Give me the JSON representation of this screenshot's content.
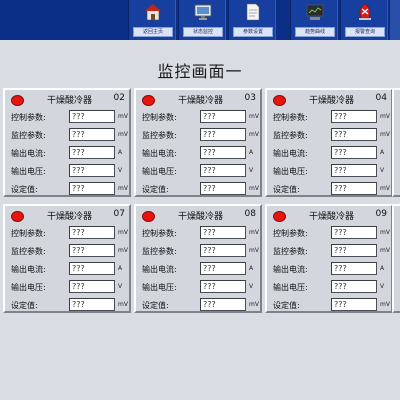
{
  "nav": {
    "items": [
      {
        "label": "返回主页",
        "icon": "home-icon"
      },
      {
        "label": "状态监控",
        "icon": "monitor-icon"
      },
      {
        "label": "参数设置",
        "icon": "document-icon"
      },
      {
        "label": "趋势曲线",
        "icon": "trend-monitor-icon"
      },
      {
        "label": "报警查询",
        "icon": "alarm-icon"
      }
    ]
  },
  "page": {
    "title": "监控画面一"
  },
  "labels": {
    "control": "控制参数:",
    "monitor": "监控参数:",
    "current": "输出电流:",
    "voltage": "输出电压:",
    "setpoint": "设定值:"
  },
  "panels": [
    {
      "name": "干燥酸冷器",
      "number": "02",
      "control_value": "???",
      "control_unit": "mV",
      "monitor_value": "???",
      "monitor_unit": "mV",
      "current_value": "???",
      "current_unit": "A",
      "voltage_value": "???",
      "voltage_unit": "V",
      "setpoint_value": "???",
      "setpoint_unit": "mV"
    },
    {
      "name": "干燥酸冷器",
      "number": "03",
      "control_value": "???",
      "control_unit": "mV",
      "monitor_value": "???",
      "monitor_unit": "mV",
      "current_value": "???",
      "current_unit": "A",
      "voltage_value": "???",
      "voltage_unit": "V",
      "setpoint_value": "???",
      "setpoint_unit": "mV"
    },
    {
      "name": "干燥酸冷器",
      "number": "04",
      "control_value": "???",
      "control_unit": "mV",
      "monitor_value": "???",
      "monitor_unit": "mV",
      "current_value": "???",
      "current_unit": "A",
      "voltage_value": "???",
      "voltage_unit": "V",
      "setpoint_value": "???",
      "setpoint_unit": "mV"
    },
    {
      "name": "干燥酸冷器",
      "number": "07",
      "control_value": "???",
      "control_unit": "mV",
      "monitor_value": "???",
      "monitor_unit": "mV",
      "current_value": "???",
      "current_unit": "A",
      "voltage_value": "???",
      "voltage_unit": "V",
      "setpoint_value": "???",
      "setpoint_unit": "mV"
    },
    {
      "name": "干燥酸冷器",
      "number": "08",
      "control_value": "???",
      "control_unit": "mV",
      "monitor_value": "???",
      "monitor_unit": "mV",
      "current_value": "???",
      "current_unit": "A",
      "voltage_value": "???",
      "voltage_unit": "V",
      "setpoint_value": "???",
      "setpoint_unit": "mV"
    },
    {
      "name": "干燥酸冷器",
      "number": "09",
      "control_value": "???",
      "control_unit": "mV",
      "monitor_value": "???",
      "monitor_unit": "mV",
      "current_value": "???",
      "current_unit": "A",
      "voltage_value": "???",
      "voltage_unit": "V",
      "setpoint_value": "???",
      "setpoint_unit": "mV"
    }
  ],
  "colors": {
    "topbar": "#0b2f86",
    "status_led": "#e8140e",
    "panel_bg": "#d3d6dd"
  }
}
